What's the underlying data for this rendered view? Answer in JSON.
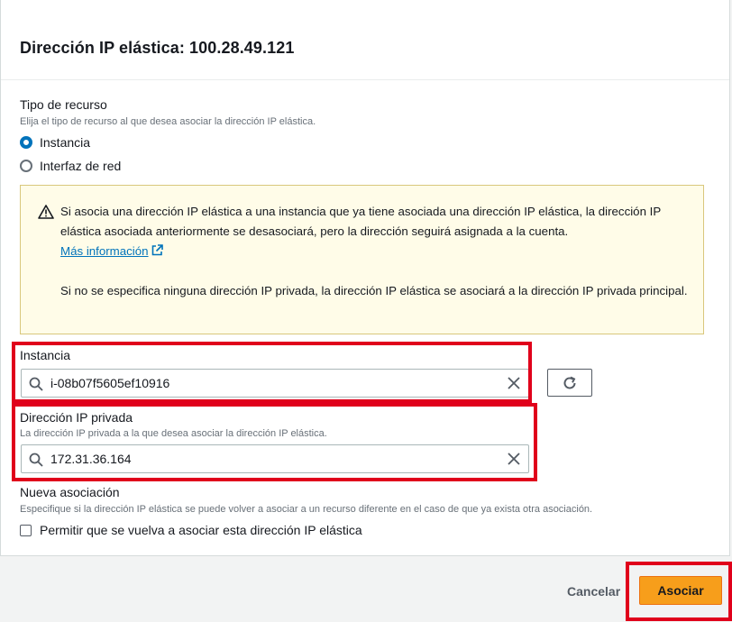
{
  "dialog": {
    "title": "Dirección IP elástica: 100.28.49.121"
  },
  "resource_type": {
    "label": "Tipo de recurso",
    "description": "Elija el tipo de recurso al que desea asociar la dirección IP elástica.",
    "options": [
      {
        "label": "Instancia",
        "selected": true
      },
      {
        "label": "Interfaz de red",
        "selected": false
      }
    ]
  },
  "alert": {
    "text1": "Si asocia una dirección IP elástica a una instancia que ya tiene asociada una dirección IP elástica, la dirección IP elástica asociada anteriormente se desasociará, pero la dirección seguirá asignada a la cuenta.",
    "link": "Más información",
    "text2": "Si no se especifica ninguna dirección IP privada, la dirección IP elástica se asociará a la dirección IP privada principal."
  },
  "instance": {
    "label": "Instancia",
    "value": "i-08b07f5605ef10916"
  },
  "private_ip": {
    "label": "Dirección IP privada",
    "description": "La dirección IP privada a la que desea asociar la dirección IP elástica.",
    "value": "172.31.36.164"
  },
  "reassociation": {
    "label": "Nueva asociación",
    "description": "Especifique si la dirección IP elástica se puede volver a asociar a un recurso diferente en el caso de que ya exista otra asociación.",
    "checkbox_label": "Permitir que se vuelva a asociar esta dirección IP elástica",
    "checked": false
  },
  "footer": {
    "cancel_label": "Cancelar",
    "associate_label": "Asociar"
  },
  "colors": {
    "primary_button": "#f79e1b",
    "highlight": "#e0001b",
    "link": "#0073bb",
    "alert_bg": "#fffce8"
  }
}
